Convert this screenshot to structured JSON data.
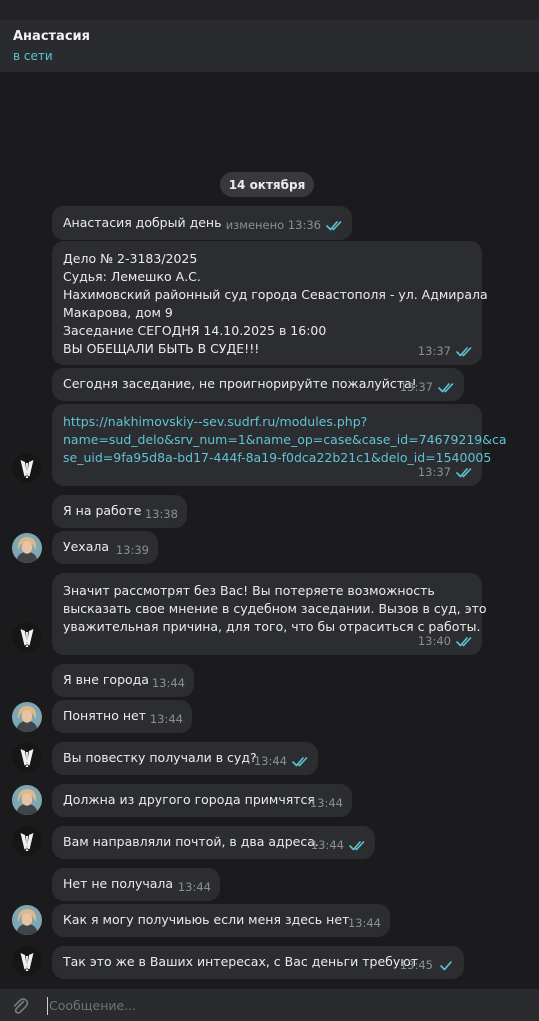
{
  "header": {
    "contact_name": "Анастасия",
    "status": "в сети"
  },
  "date_separator": "14 октября",
  "messages": [
    {
      "text": "Анастасия добрый день",
      "time": "изменено 13:36",
      "read": true
    },
    {
      "lines": [
        "Дело № 2-3183/2025",
        "Судья: Лемешко А.С.",
        "Нахимовский районный суд города Севастополя - ул. Адмирала",
        "Макарова, дом 9",
        "Заседание СЕГОДНЯ 14.10.2025 в 16:00",
        "ВЫ ОБЕЩАЛИ БЫТЬ В СУДЕ!!!"
      ],
      "time": "13:37",
      "read": true
    },
    {
      "text": "Сегодня заседание, не проигнорируйте пожалуйста!",
      "time": "13:37",
      "read": true
    },
    {
      "lines": [
        "https://nakhimovskiy--sev.sudrf.ru/modules.php?",
        "name=sud_delo&srv_num=1&name_op=case&case_id=74679219&ca",
        "se_uid=9fa95d8a-bd17-444f-8a19-f0dca22b21c1&delo_id=1540005"
      ],
      "time": "13:37",
      "read": true
    },
    {
      "text": "Я на работе",
      "time": "13:38"
    },
    {
      "text": "Уехала",
      "time": "13:39"
    },
    {
      "lines": [
        "Значит рассмотрят без Вас! Вы потеряете возможность",
        "высказать свое мнение в судебном заседании. Вызов в суд, это",
        "уважительная причина, для того, что бы отраситься с работы."
      ],
      "time": "13:40",
      "read": true
    },
    {
      "text": "Я вне города",
      "time": "13:44"
    },
    {
      "text": "Понятно нет",
      "time": "13:44"
    },
    {
      "text": "Вы повестку получали в суд?",
      "time": "13:44",
      "read": true
    },
    {
      "text": "Должна из другого города примчятся",
      "time": "13:44"
    },
    {
      "text": "Вам направляли почтой, в два адреса.",
      "time": "13:44",
      "read": true
    },
    {
      "text": "Нет не получала",
      "time": "13:44"
    },
    {
      "text": "Как я могу получиьюь если меня здесь нет",
      "time": "13:44"
    },
    {
      "text": "Так это же в Ваших интересах, с Вас деньги требуют",
      "time": "13:45",
      "read": true
    }
  ],
  "composer": {
    "placeholder": "Сообщение..."
  },
  "colors": {
    "accent": "#5fc3d6",
    "bubble": "#2c2d30",
    "background": "#1b1b1d",
    "read_ticks": "#5fc3d6"
  },
  "icons": {
    "attach": "paperclip-icon",
    "read": "double-check-icon",
    "sent": "check-icon"
  }
}
